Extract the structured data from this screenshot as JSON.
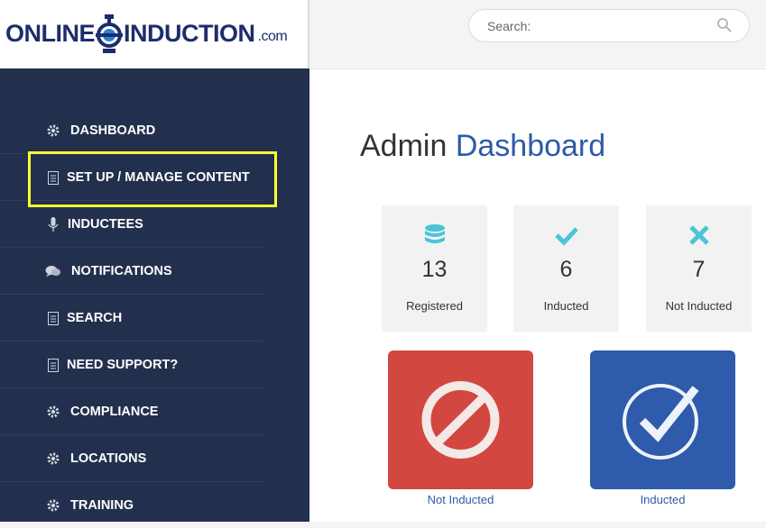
{
  "brand": {
    "logo_left": "ONLINE",
    "logo_right": "INDUCTION",
    "logo_suffix": ".com"
  },
  "search": {
    "placeholder": "Search:"
  },
  "sidebar": {
    "items": [
      {
        "label": "DASHBOARD",
        "icon": "gear-icon"
      },
      {
        "label": "SET UP / MANAGE CONTENT",
        "icon": "document-icon",
        "highlighted": true
      },
      {
        "label": "INDUCTEES",
        "icon": "microphone-icon"
      },
      {
        "label": "NOTIFICATIONS",
        "icon": "chat-icon"
      },
      {
        "label": "SEARCH",
        "icon": "document-icon"
      },
      {
        "label": "NEED SUPPORT?",
        "icon": "document-icon"
      },
      {
        "label": "COMPLIANCE",
        "icon": "gear-icon"
      },
      {
        "label": "LOCATIONS",
        "icon": "gear-icon"
      },
      {
        "label": "TRAINING",
        "icon": "gear-icon"
      }
    ]
  },
  "main": {
    "title_plain": "Admin",
    "title_accent": "Dashboard",
    "stats": [
      {
        "value": "13",
        "label": "Registered",
        "icon": "database-icon",
        "color": "#4ac4d8"
      },
      {
        "value": "6",
        "label": "Inducted",
        "icon": "check-icon",
        "color": "#4ac4d8"
      },
      {
        "value": "7",
        "label": "Not Inducted",
        "icon": "x-icon",
        "color": "#4ac4d8"
      }
    ],
    "actions": [
      {
        "label": "Not Inducted",
        "icon": "prohibited-icon",
        "color": "#d2473f"
      },
      {
        "label": "Inducted",
        "icon": "check-circle-icon",
        "color": "#2e5bab"
      }
    ]
  },
  "colors": {
    "sidebar_bg": "#23304d",
    "accent": "#2f5aa8",
    "highlight": "#ffff33"
  }
}
